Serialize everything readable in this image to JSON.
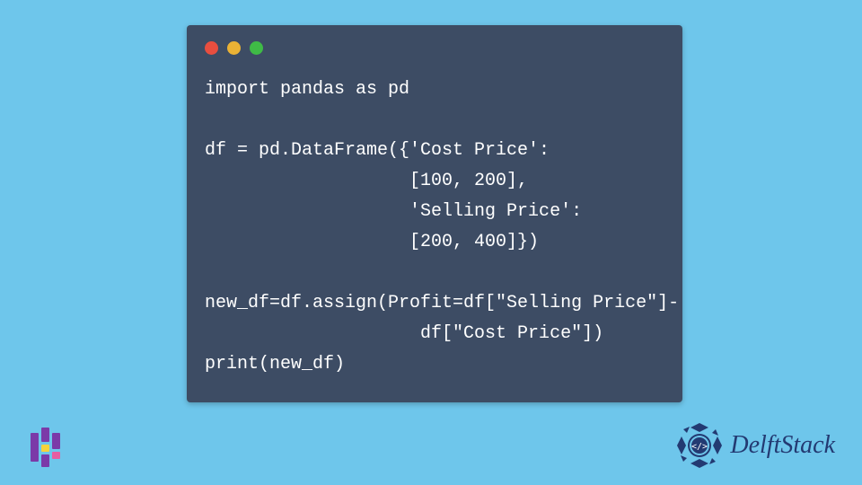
{
  "colors": {
    "bg": "#6ec6eb",
    "window": "#3d4c64",
    "code_text": "#ffffff",
    "brand_primary": "#233a72",
    "traffic_red": "#e84e3f",
    "traffic_yellow": "#eab235",
    "traffic_green": "#3fbb46",
    "logo_purple": "#7b3aa8",
    "logo_yellow": "#f6d33c",
    "logo_pink": "#e85ea1"
  },
  "code": {
    "language": "python",
    "lines": [
      "import pandas as pd",
      "",
      "df = pd.DataFrame({'Cost Price':",
      "                   [100, 200],",
      "                   'Selling Price':",
      "                   [200, 400]})",
      "",
      "new_df=df.assign(Profit=df[\"Selling Price\"]-",
      "                    df[\"Cost Price\"])",
      "print(new_df)"
    ]
  },
  "brand": {
    "name": "DelftStack"
  }
}
